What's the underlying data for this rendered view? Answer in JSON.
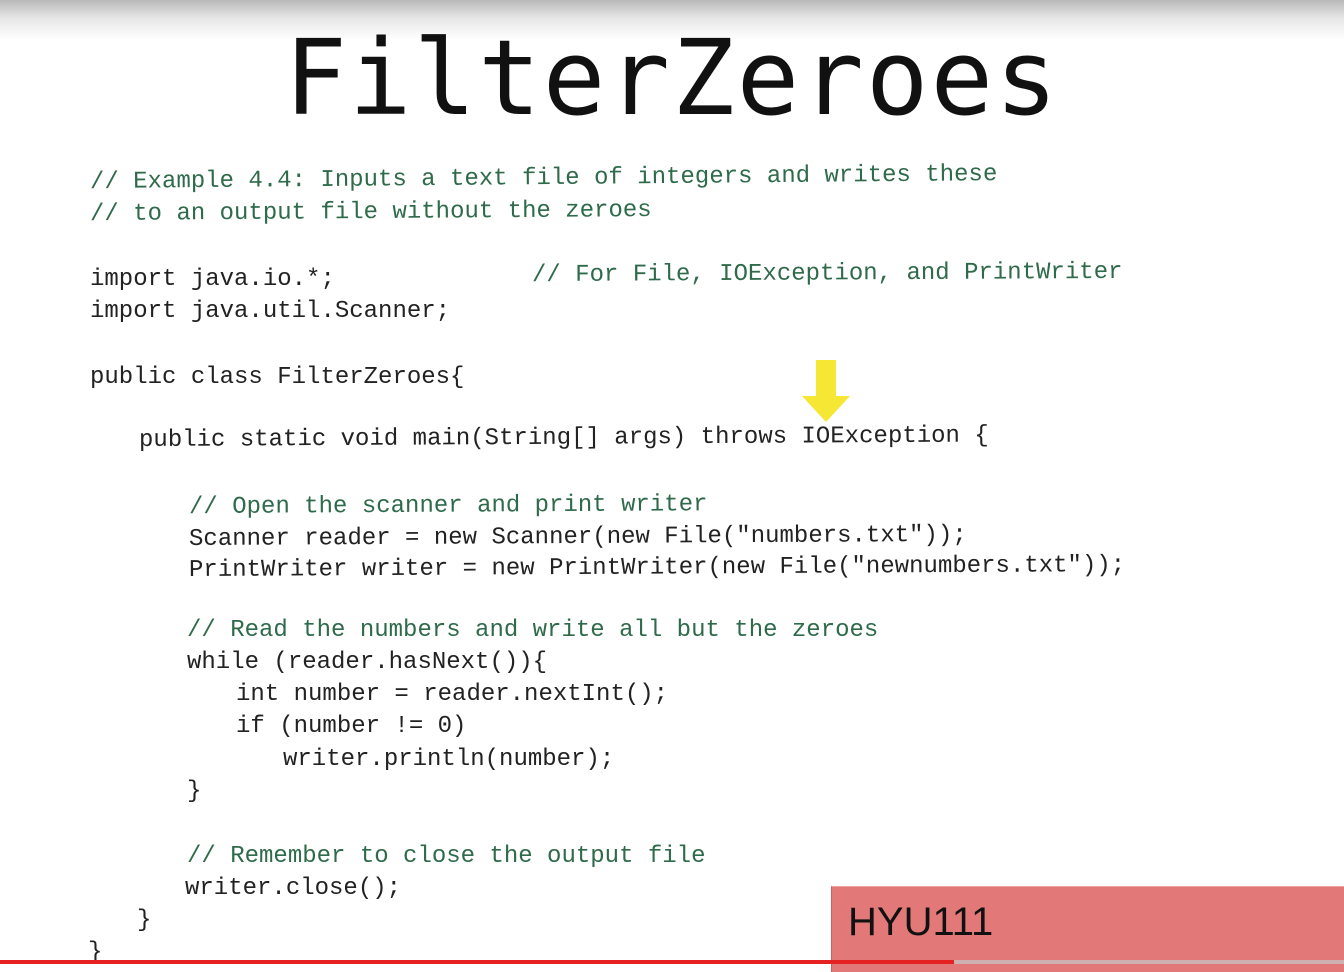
{
  "slide": {
    "title": "FilterZeroes"
  },
  "code": {
    "lines": [
      "// Example 4.4: Inputs a text file of integers and writes these",
      "// to an output file without the zeroes",
      "import java.io.*;",
      "// For File, IOException, and PrintWriter",
      "import java.util.Scanner;",
      "public class FilterZeroes{",
      "public static void main(String[] args) throws IOException {",
      "// Open the scanner and print writer",
      "Scanner reader = new Scanner(new File(\"numbers.txt\"));",
      "PrintWriter writer = new PrintWriter(new File(\"newnumbers.txt\"));",
      "// Read the numbers and write all but the zeroes",
      "while (reader.hasNext()){",
      "int number = reader.nextInt();",
      "if (number != 0)",
      "writer.println(number);",
      "}",
      "// Remember to close the output file",
      "writer.close();",
      "}",
      "}"
    ]
  },
  "annotation": {
    "arrow_icon": "down-arrow-icon",
    "arrow_color": "#f5e733"
  },
  "channel": {
    "label": "HYU111",
    "banner_color": "#e27878"
  },
  "video": {
    "progress_fraction": 0.71,
    "progress_color": "#e52222"
  },
  "colors": {
    "code_text": "#222222",
    "comment_text": "#2f6b4a"
  }
}
